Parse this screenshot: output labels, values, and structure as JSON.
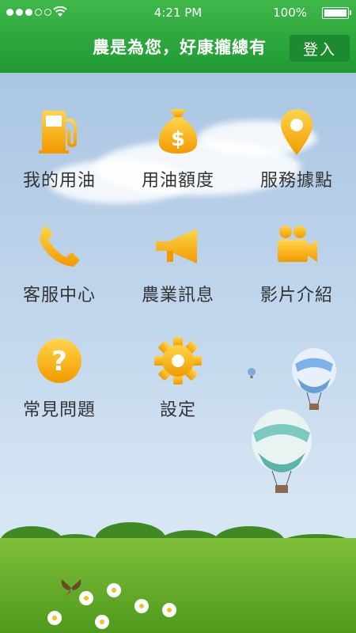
{
  "status_bar": {
    "time": "4:21 PM",
    "battery": "100%",
    "battery_level": 1.0
  },
  "header": {
    "title": "農是為您，好康攏總有",
    "login_label": "登入"
  },
  "menu": [
    {
      "label": "我的用油",
      "icon": "fuel-pump-icon"
    },
    {
      "label": "用油額度",
      "icon": "money-bag-icon"
    },
    {
      "label": "服務據點",
      "icon": "location-pin-icon"
    },
    {
      "label": "客服中心",
      "icon": "phone-icon"
    },
    {
      "label": "農業訊息",
      "icon": "megaphone-icon"
    },
    {
      "label": "影片介紹",
      "icon": "video-camera-icon"
    },
    {
      "label": "常見問題",
      "icon": "question-icon"
    },
    {
      "label": "設定",
      "icon": "gear-icon"
    }
  ],
  "colors": {
    "header_green": "#1f9a33",
    "icon_gold": "#f5b100",
    "label": "#333333"
  }
}
